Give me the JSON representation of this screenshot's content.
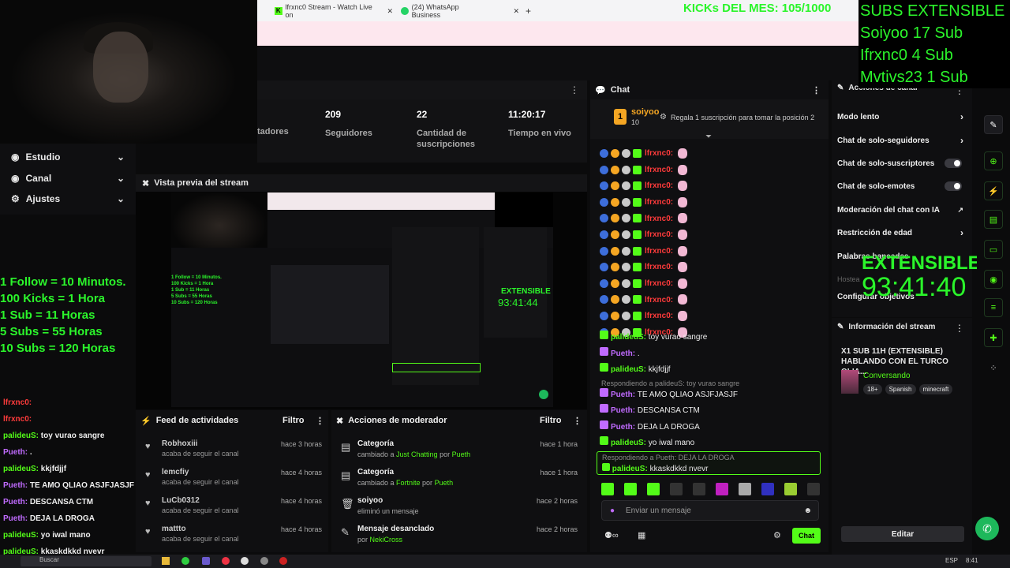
{
  "browser": {
    "tab1": "lfrxnc0 Stream - Watch Live on",
    "tab2": "(24) WhatsApp Business",
    "new_tab": "+"
  },
  "overlay": {
    "kicks": "KICKs DEL MES: 105/1000",
    "subs_title": "SUBS EXTENSIBLE",
    "subs": [
      "Soiyoo 17 Sub",
      "Ifrxnc0 4 Sub",
      "Mvtivs23 1 Sub"
    ],
    "rules": [
      "1 Follow = 10 Minutos.",
      "100 Kicks = 1 Hora",
      "1 Sub = 11 Horas",
      "5 Subs = 55 Horas",
      "10 Subs = 120 Horas"
    ],
    "extensible": "EXTENSIBLE",
    "timer": "93:41:40"
  },
  "stats": [
    {
      "num": "",
      "label": "tadores"
    },
    {
      "num": "209",
      "label": "Seguidores"
    },
    {
      "num": "22",
      "label": "Cantidad de suscripciones"
    },
    {
      "num": "11:20:17",
      "label": "Tiempo en vivo"
    }
  ],
  "sidebar": {
    "items": [
      {
        "label": "Estudio",
        "icon": "studio-icon"
      },
      {
        "label": "Canal",
        "icon": "channel-icon"
      },
      {
        "label": "Ajustes",
        "icon": "settings-icon"
      }
    ]
  },
  "preview": {
    "title": "Vista previa del stream"
  },
  "feed": {
    "title": "Feed de actividades",
    "filter": "Filtro",
    "rows": [
      {
        "name": "Robhoxiii",
        "sub": "acaba de seguir el canal",
        "time": "hace 3 horas"
      },
      {
        "name": "lemcfiy",
        "sub": "acaba de seguir el canal",
        "time": "hace 4 horas"
      },
      {
        "name": "LuCb0312",
        "sub": "acaba de seguir el canal",
        "time": "hace 4 horas"
      },
      {
        "name": "mattto",
        "sub": "acaba de seguir el canal",
        "time": "hace 4 horas"
      }
    ]
  },
  "modactions": {
    "title": "Acciones de moderador",
    "filter": "Filtro",
    "rows": [
      {
        "title": "Categoría",
        "sub_pre": "cambiado a ",
        "sub_hl": "Just Chatting",
        "sub_mid": " por ",
        "sub_user": "Pueth",
        "time": "hace 1 hora"
      },
      {
        "title": "Categoría",
        "sub_pre": "cambiado a ",
        "sub_hl": "Fortnite",
        "sub_mid": " por ",
        "sub_user": "Pueth",
        "time": "hace 1 hora"
      },
      {
        "title": "soiyoo",
        "sub_pre": "eliminó un mensaje",
        "sub_hl": "",
        "sub_mid": "",
        "sub_user": "",
        "time": "hace 2 horas"
      },
      {
        "title": "Mensaje desanclado",
        "sub_pre": "por ",
        "sub_hl": "",
        "sub_mid": "",
        "sub_user": "NekiCross",
        "time": "hace 2 horas"
      }
    ]
  },
  "overlay_chat": [
    {
      "user": "lfrxnc0:",
      "msg": "",
      "color": "#ff3b3b"
    },
    {
      "user": "lfrxnc0:",
      "msg": "",
      "color": "#ff3b3b"
    },
    {
      "user": "palideuS:",
      "msg": " toy vurao sangre",
      "color": "#53fc18"
    },
    {
      "user": "Pueth:",
      "msg": " .",
      "color": "#c06bff"
    },
    {
      "user": "palideuS:",
      "msg": " kkjfdjjf",
      "color": "#53fc18"
    },
    {
      "user": "Pueth:",
      "msg": " TE AMO QLIAO ASJFJASJF",
      "color": "#c06bff"
    },
    {
      "user": "Pueth:",
      "msg": " DESCANSA CTM",
      "color": "#c06bff"
    },
    {
      "user": "Pueth:",
      "msg": " DEJA LA DROGA",
      "color": "#c06bff"
    },
    {
      "user": "palideuS:",
      "msg": " yo iwal mano",
      "color": "#53fc18"
    },
    {
      "user": "palideuS:",
      "msg": " kkaskdkkd nvevr",
      "color": "#53fc18"
    }
  ],
  "chat": {
    "title": "Chat",
    "pinned_user": "soiyoo",
    "pinned_count": "10",
    "pinned_rank": "1",
    "pinned_msg": "Regala 1 suscripción para tomar la posición 2",
    "spam_user": "lfrxnc0:",
    "messages": [
      {
        "user": "palideuS:",
        "msg": " toy vurao sangre",
        "color": "#53fc18",
        "reply": ""
      },
      {
        "user": "Pueth:",
        "msg": " .",
        "color": "#c06bff",
        "reply": ""
      },
      {
        "user": "palideuS:",
        "msg": " kkjfdjjf",
        "color": "#53fc18",
        "reply": ""
      },
      {
        "user": "Pueth:",
        "msg": " TE AMO QLIAO ASJFJASJF",
        "color": "#c06bff",
        "reply": "Respondiendo a palideuS: toy vurao sangre"
      },
      {
        "user": "Pueth:",
        "msg": " DESCANSA CTM",
        "color": "#c06bff",
        "reply": ""
      },
      {
        "user": "Pueth:",
        "msg": " DEJA LA DROGA",
        "color": "#c06bff",
        "reply": ""
      },
      {
        "user": "palideuS:",
        "msg": " yo iwal mano",
        "color": "#53fc18",
        "reply": ""
      }
    ],
    "reply_ctx": "Respondiendo a Pueth: DEJA LA DROGA",
    "reply_user": "palideuS:",
    "reply_msg": " kkaskdkkd nvevr",
    "input_placeholder": "Enviar un mensaje",
    "send_label": "Chat"
  },
  "mod_panel": {
    "title": "Acciones de canal",
    "items": [
      {
        "label": "Modo lento",
        "type": "arrow"
      },
      {
        "label": "Chat de solo-seguidores",
        "type": "arrow"
      },
      {
        "label": "Chat de solo-suscriptores",
        "type": "toggle"
      },
      {
        "label": "Chat de solo-emotes",
        "type": "toggle"
      },
      {
        "label": "Moderación del chat con IA",
        "type": "ext"
      },
      {
        "label": "Restricción de edad",
        "type": "arrow"
      },
      {
        "label": "Palabras baneadas",
        "type": "none"
      },
      {
        "label": "Hostea",
        "type": "none"
      },
      {
        "label": "Configurar objetivos",
        "type": "none"
      }
    ]
  },
  "stream_info": {
    "title": "Información del stream",
    "stream_title": "X1 SUB 11H (EXTENSIBLE) HABLANDO CON EL TURCO QLIA...",
    "category": "Conversando",
    "tags": [
      "18+",
      "Spanish",
      "minecraft"
    ],
    "edit_label": "Editar"
  },
  "taskbar": {
    "search": "Buscar",
    "lang": "ESP",
    "time": "8:41"
  }
}
